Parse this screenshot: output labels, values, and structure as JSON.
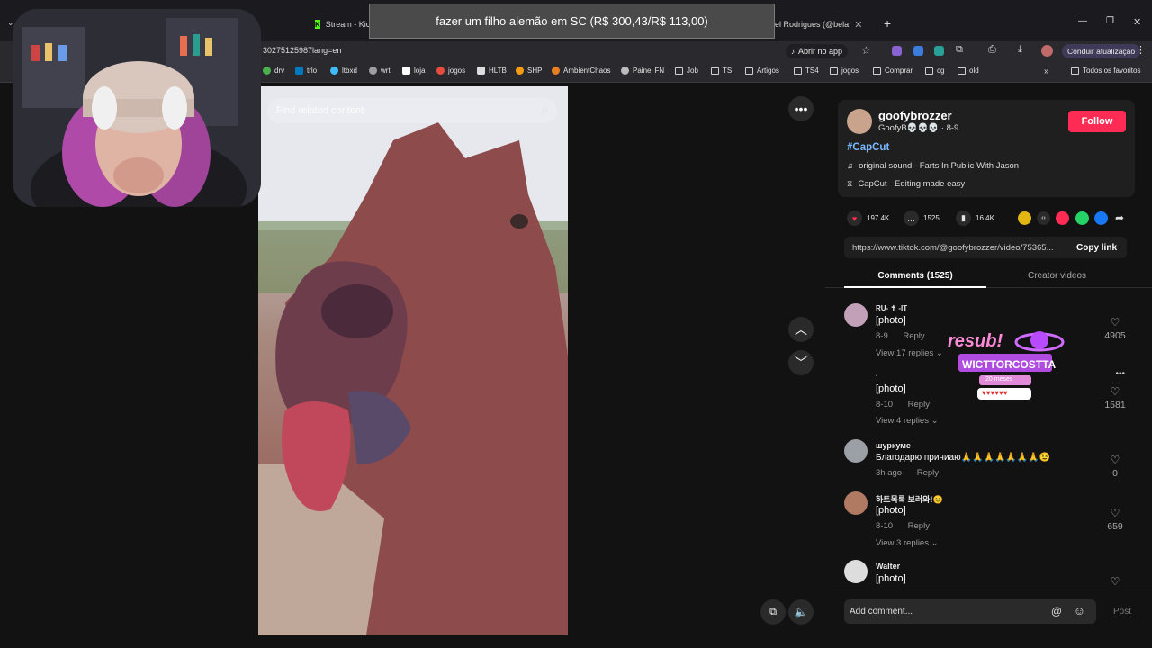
{
  "browser": {
    "tabs": [
      {
        "label": "Stream - Kick"
      },
      {
        "label": "el Rodrigues (@bela"
      }
    ],
    "address": "30275125987lang=en",
    "open_app_label": "Abrir no app",
    "update_label": "Conduir atualização",
    "bookmarks": [
      "drv",
      "trlo",
      "ltbxd",
      "wrt",
      "loja",
      "jogos",
      "HLTB",
      "SHP",
      "AmbientChaos",
      "Painel FN",
      "Job",
      "TS",
      "Artigos",
      "TS4",
      "jogos",
      "Comprar",
      "cg",
      "old"
    ],
    "all_favorites_label": "Todos os favoritos"
  },
  "toast": {
    "text": "fazer um filho alemão em SC (R$ 300,43/R$ 113,00)"
  },
  "video": {
    "search_placeholder": "Find related content"
  },
  "author": {
    "username": "goofybrozzer",
    "display": "GoofyB💀💀💀 · 8-9",
    "follow_label": "Follow",
    "hashtag": "#CapCut",
    "sound": "original sound - Farts In Public With Jason",
    "capcut": "CapCut · Editing made easy"
  },
  "stats": {
    "likes": "197.4K",
    "comments": "1525",
    "saves": "16.4K"
  },
  "link": {
    "url": "https://www.tiktok.com/@goofybrozzer/video/75365...",
    "copy_label": "Copy link"
  },
  "tabs": {
    "comments": "Comments (1525)",
    "creator": "Creator videos"
  },
  "comments": [
    {
      "user": "RU- ✝ -IT",
      "text": "[photo]",
      "date": "8-9",
      "reply": "Reply",
      "view": "View 17 replies",
      "likes": "4905"
    },
    {
      "user": ".",
      "text": "[photo]",
      "date": "8-10",
      "reply": "Reply",
      "view": "View 4 replies",
      "likes": "1581"
    },
    {
      "user": "шуркуме",
      "text": "Благодарю приниаю🙏🙏🙏🙏🙏🙏🙏😉",
      "date": "3h ago",
      "reply": "Reply",
      "view": "",
      "likes": "0"
    },
    {
      "user": "하트목록 보러와!😊",
      "text": "[photo]",
      "date": "8-10",
      "reply": "Reply",
      "view": "View 3 replies",
      "likes": "659"
    },
    {
      "user": "Walter",
      "text": "[photo]",
      "date": "",
      "reply": "",
      "view": "",
      "likes": ""
    }
  ],
  "comment_bar": {
    "placeholder": "Add comment...",
    "post_label": "Post"
  },
  "sticker": {
    "top": "resub!",
    "name": "WICTTORCOSTTA",
    "sub": "20 meses"
  }
}
